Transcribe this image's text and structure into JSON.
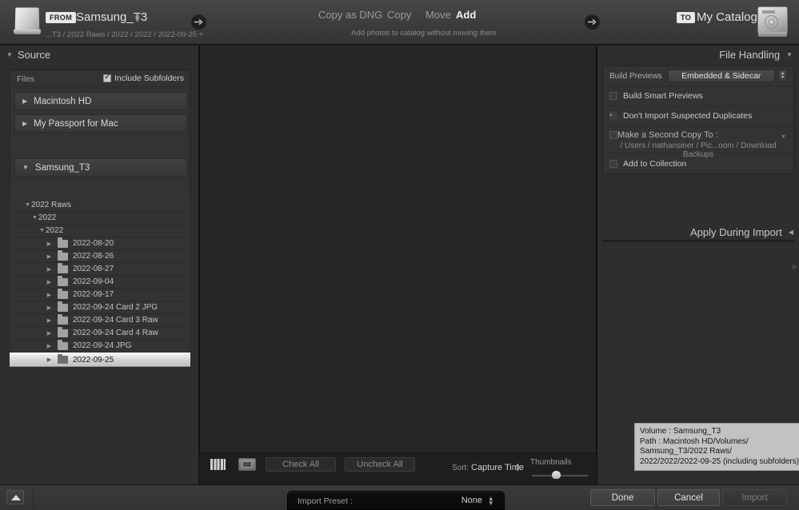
{
  "header": {
    "drive_icon": "external-drive-icon",
    "from_badge": "FROM",
    "source_name": "Samsung_T3",
    "source_path": "...T3 / 2022 Raws / 2022 / 2022 / 2022-09-25 +",
    "arrow_icon": "arrow-right-icon",
    "modes": [
      {
        "label": "Copy as DNG",
        "active": false
      },
      {
        "label": "Copy",
        "active": false
      },
      {
        "label": "Move",
        "active": false
      },
      {
        "label": "Add",
        "active": true
      }
    ],
    "mode_description": "Add photos to catalog without moving them",
    "to_badge": "TO",
    "catalog_name": "My Catalog",
    "catalog_icon": "hard-drive-icon"
  },
  "source": {
    "title": "Source",
    "collapse_icon": "triangle-down-icon",
    "files_label": "Files",
    "include_subfolders_label": "Include Subfolders",
    "include_subfolders_checked": true,
    "volumes": [
      {
        "name": "Macintosh HD",
        "expanded": false
      },
      {
        "name": "My Passport for Mac",
        "expanded": false
      },
      {
        "name": "Samsung_T3",
        "expanded": true
      }
    ],
    "tree": [
      {
        "label": "2022 Raws",
        "indent": 0,
        "expanded": true,
        "folder": false,
        "selected": false
      },
      {
        "label": "2022",
        "indent": 1,
        "expanded": true,
        "folder": false,
        "selected": false
      },
      {
        "label": "2022",
        "indent": 2,
        "expanded": true,
        "folder": false,
        "selected": false
      },
      {
        "label": "2022-08-20",
        "indent": 3,
        "expanded": false,
        "folder": true,
        "selected": false
      },
      {
        "label": "2022-08-26",
        "indent": 3,
        "expanded": false,
        "folder": true,
        "selected": false
      },
      {
        "label": "2022-08-27",
        "indent": 3,
        "expanded": false,
        "folder": true,
        "selected": false
      },
      {
        "label": "2022-09-04",
        "indent": 3,
        "expanded": false,
        "folder": true,
        "selected": false
      },
      {
        "label": "2022-09-17",
        "indent": 3,
        "expanded": false,
        "folder": true,
        "selected": false
      },
      {
        "label": "2022-09-24 Card 2 JPG",
        "indent": 3,
        "expanded": false,
        "folder": true,
        "selected": false
      },
      {
        "label": "2022-09-24 Card 3 Raw",
        "indent": 3,
        "expanded": false,
        "folder": true,
        "selected": false
      },
      {
        "label": "2022-09-24 Card 4 Raw",
        "indent": 3,
        "expanded": false,
        "folder": true,
        "selected": false
      },
      {
        "label": "2022-09-24 JPG",
        "indent": 3,
        "expanded": false,
        "folder": true,
        "selected": false
      },
      {
        "label": "2022-09-25",
        "indent": 3,
        "expanded": false,
        "folder": true,
        "selected": true
      }
    ]
  },
  "file_handling": {
    "title": "File Handling",
    "collapse_icon": "triangle-down-icon",
    "build_previews_label": "Build Previews",
    "build_previews_value": "Embedded & Sidecar",
    "build_smart_previews_label": "Build Smart Previews",
    "build_smart_previews_checked": false,
    "dont_import_duplicates_label": "Don't Import Suspected Duplicates",
    "dont_import_duplicates_checked": true,
    "second_copy_label": "Make a Second Copy To :",
    "second_copy_checked": false,
    "second_copy_path": "/ Users / nathansiner / Pic...oom / Download Backups",
    "add_to_collection_label": "Add to Collection",
    "add_to_collection_checked": false
  },
  "apply_during_import": {
    "title": "Apply During Import",
    "collapse_icon": "triangle-left-icon"
  },
  "tooltip": {
    "line1": "Volume : Samsung_T3",
    "line2": "Path : Macintosh HD/Volumes/",
    "line3": "Samsung_T3/2022 Raws/",
    "line4": "2022/2022/2022-09-25 (including subfolders)"
  },
  "toolbar": {
    "grid_view_icon": "grid-view-icon",
    "loupe_view_icon": "loupe-view-icon",
    "check_all_label": "Check All",
    "uncheck_all_label": "Uncheck All",
    "sort_label": "Sort:",
    "sort_value": "Capture Time",
    "thumbnails_label": "Thumbnails"
  },
  "bottom": {
    "eject_icon": "eject-icon",
    "import_preset_label": "Import Preset :",
    "import_preset_value": "None",
    "done_label": "Done",
    "cancel_label": "Cancel",
    "import_label": "Import"
  },
  "colors": {
    "panel_bg": "#2e2e2e",
    "center_bg": "#262626",
    "header_bg": "#3e3e3e",
    "selection": "#d2d2d2",
    "tooltip_bg": "#c2c2c2",
    "text": "#b4b4b4"
  }
}
